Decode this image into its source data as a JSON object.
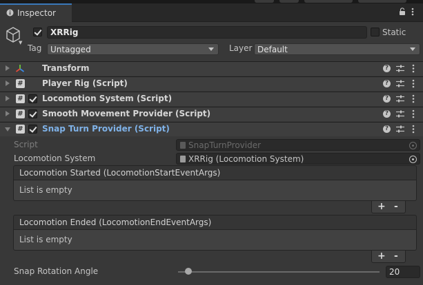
{
  "window": {
    "tab_title": "Inspector"
  },
  "header": {
    "object_name": "XRRig",
    "active": true,
    "static_label": "Static",
    "static_checked": false,
    "tag_label": "Tag",
    "tag_value": "Untagged",
    "layer_label": "Layer",
    "layer_value": "Default"
  },
  "components": [
    {
      "title": "Transform",
      "has_checkbox": false,
      "icon": "transform-icon",
      "expanded": false
    },
    {
      "title": "Player Rig (Script)",
      "has_checkbox": false,
      "icon": "script-icon",
      "expanded": false
    },
    {
      "title": "Locomotion System (Script)",
      "has_checkbox": true,
      "checked": true,
      "icon": "script-icon",
      "expanded": false
    },
    {
      "title": "Smooth Movement Provider (Script)",
      "has_checkbox": true,
      "checked": true,
      "icon": "script-icon",
      "expanded": false
    },
    {
      "title": "Snap Turn Provider (Script)",
      "has_checkbox": true,
      "checked": true,
      "icon": "script-icon",
      "expanded": true
    }
  ],
  "snap_turn": {
    "script_label": "Script",
    "script_value": "SnapTurnProvider",
    "locomotion_label": "Locomotion System",
    "locomotion_value": "XRRig (Locomotion System)",
    "events": [
      {
        "title": "Locomotion Started (LocomotionStartEventArgs)",
        "empty_text": "List is empty"
      },
      {
        "title": "Locomotion Ended (LocomotionEndEventArgs)",
        "empty_text": "List is empty"
      }
    ],
    "add_label": "+",
    "remove_label": "-",
    "angle_label": "Snap Rotation Angle",
    "angle_value": "20",
    "angle_slider_fraction": 0.05
  },
  "colors": {
    "accent": "#3a79bb",
    "selected_title": "#7fb2e8",
    "background": "#383838"
  }
}
